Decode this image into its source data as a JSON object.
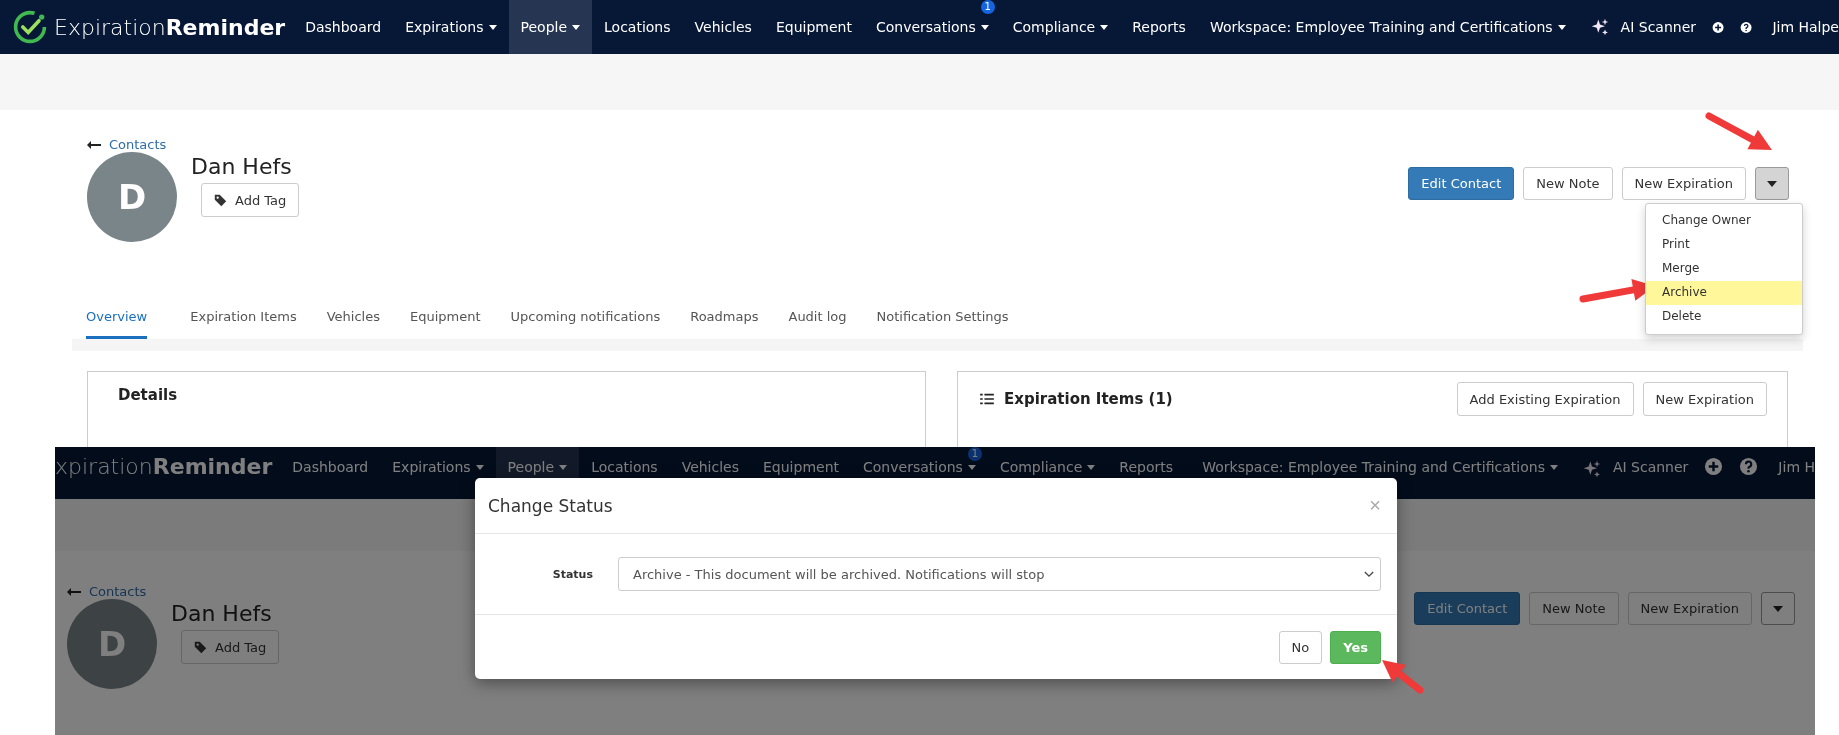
{
  "top_screen": {
    "nav": {
      "logo_icon": true,
      "logo": "Expiration**Reminder**",
      "items": [
        {
          "label": "Dashboard",
          "dropdown": false,
          "selected": false
        },
        {
          "label": "Expirations",
          "dropdown": true,
          "selected": false
        },
        {
          "label": "People",
          "dropdown": true,
          "selected": true
        },
        {
          "label": "Locations",
          "dropdown": false,
          "selected": false
        },
        {
          "label": "Vehicles",
          "dropdown": false,
          "selected": false
        },
        {
          "label": "Equipment",
          "dropdown": false,
          "selected": false
        },
        {
          "label": "Conversations",
          "dropdown": true,
          "selected": false,
          "badge": "1"
        },
        {
          "label": "Compliance",
          "dropdown": true,
          "selected": false
        },
        {
          "label": "Reports",
          "dropdown": false,
          "selected": false
        }
      ],
      "workspace": "Workspace: Employee Training and Certifications",
      "ai_scanner": "AI Scanner",
      "user": "Jim Halpe"
    },
    "back_link": "Contacts",
    "avatar_initial": "D",
    "name": "Dan Hefs",
    "add_tag": "Add Tag",
    "actions": [
      {
        "label": "Edit Contact",
        "kind": "primary"
      },
      {
        "label": "New Note",
        "kind": "default"
      },
      {
        "label": "New Expiration",
        "kind": "default"
      }
    ],
    "menu": [
      {
        "label": "Change Owner",
        "selected": false
      },
      {
        "label": "Print",
        "selected": false
      },
      {
        "label": "Merge",
        "selected": false
      },
      {
        "label": "Archive",
        "selected": true
      },
      {
        "label": "Delete",
        "selected": false
      }
    ],
    "tabs": [
      {
        "label": "Overview",
        "selected": true
      },
      {
        "label": "Expiration Items",
        "selected": false
      },
      {
        "label": "Vehicles",
        "selected": false
      },
      {
        "label": "Equipment",
        "selected": false
      },
      {
        "label": "Upcoming notifications",
        "selected": false
      },
      {
        "label": "Roadmaps",
        "selected": false
      },
      {
        "label": "Audit log",
        "selected": false
      },
      {
        "label": "Notification Settings",
        "selected": false
      }
    ],
    "cards": [
      {
        "title": "Details",
        "kind": "plain"
      },
      {
        "title": "Expiration Items (1)",
        "kind": "list",
        "buttons": [
          "Add Existing Expiration",
          "New Expiration"
        ]
      }
    ]
  },
  "bottom_screen": {
    "nav": {
      "logo_icon": false,
      "logo": "xpiration**Reminder**",
      "items": [
        {
          "label": "Dashboard",
          "dropdown": false,
          "selected": false
        },
        {
          "label": "Expirations",
          "dropdown": true,
          "selected": false
        },
        {
          "label": "People",
          "dropdown": true,
          "selected": true
        },
        {
          "label": "Locations",
          "dropdown": false,
          "selected": false
        },
        {
          "label": "Vehicles",
          "dropdown": false,
          "selected": false
        },
        {
          "label": "Equipment",
          "dropdown": false,
          "selected": false
        },
        {
          "label": "Conversations",
          "dropdown": true,
          "selected": false,
          "badge": "1"
        },
        {
          "label": "Compliance",
          "dropdown": true,
          "selected": false
        },
        {
          "label": "Reports",
          "dropdown": false,
          "selected": false
        }
      ],
      "workspace": "Workspace: Employee Training and Certifications",
      "ai_scanner": "AI Scanner",
      "user": "Jim H"
    },
    "back_link": "Contacts",
    "avatar_initial": "D",
    "name": "Dan Hefs",
    "add_tag": "Add Tag",
    "actions": [
      {
        "label": "Edit Contact",
        "kind": "primary"
      },
      {
        "label": "New Note",
        "kind": "default"
      },
      {
        "label": "New Expiration",
        "kind": "default"
      }
    ],
    "modal": {
      "title": "Change Status",
      "close": "×",
      "field_label": "Status",
      "value": "Archive - This document will be archived. Notifications will stop",
      "buttons": [
        {
          "label": "No",
          "kind": "default"
        },
        {
          "label": "Yes",
          "kind": "success"
        }
      ]
    }
  }
}
